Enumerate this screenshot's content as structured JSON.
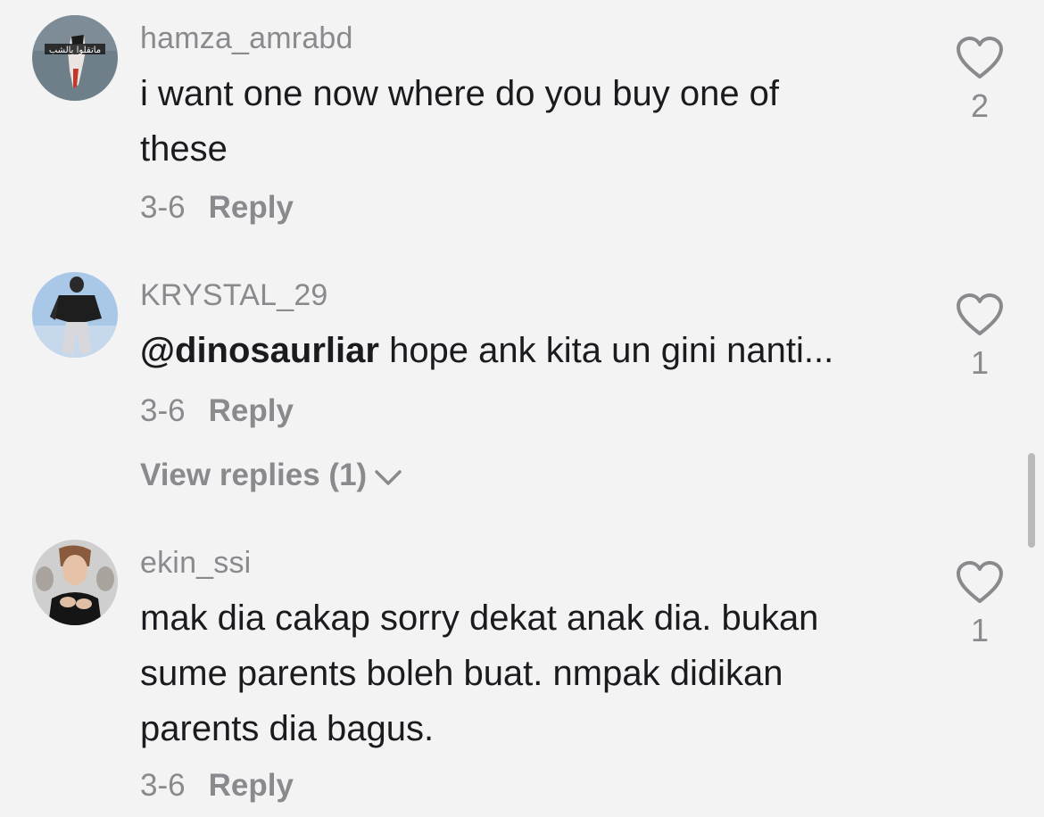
{
  "comments": [
    {
      "username": "hamza_amrabd",
      "avatar_text": "ماتقلوا بالشب",
      "text_lines": [
        "i want one now where do you buy one of",
        "these"
      ],
      "date": "3-6",
      "reply_label": "Reply",
      "likes": "2"
    },
    {
      "username": "KRYSTAL_29",
      "mention": "@dinosaurliar",
      "text_rest": " hope ank kita un gini nanti...",
      "date": "3-6",
      "reply_label": "Reply",
      "likes": "1",
      "view_replies_label": "View replies (1)"
    },
    {
      "username": "ekin_ssi",
      "text_lines": [
        "mak dia cakap sorry dekat anak dia. bukan",
        "sume parents boleh buat. nmpak didikan",
        "parents dia bagus."
      ],
      "date": "3-6",
      "reply_label": "Reply",
      "likes": "1"
    }
  ],
  "icons": {
    "like": "heart-outline-icon",
    "expand": "chevron-down-icon"
  },
  "colors": {
    "background": "#f4f3f3",
    "text": "#1b1b1f",
    "muted": "#8a8a8e"
  }
}
